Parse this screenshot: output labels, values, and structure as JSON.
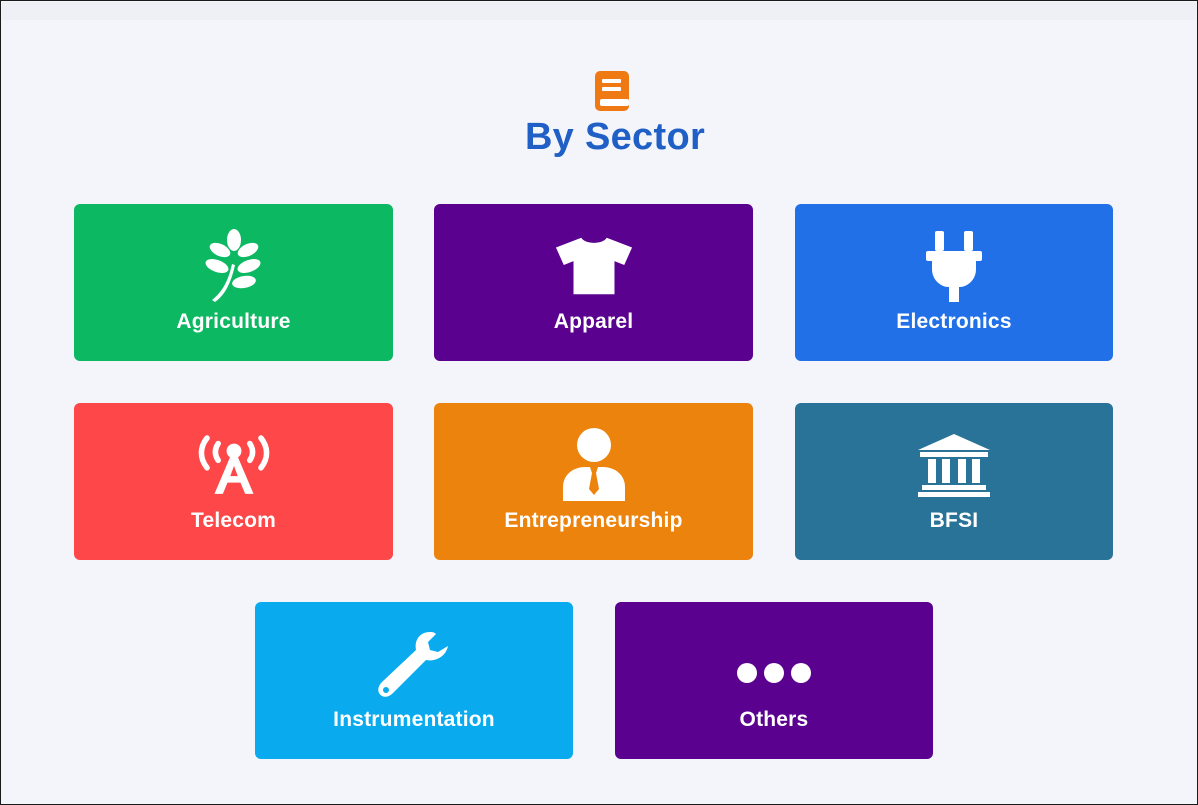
{
  "header": {
    "title": "By Sector",
    "icon": "book-icon",
    "icon_color": "#ef7a14",
    "title_color": "#1f5fc6"
  },
  "sectors": [
    {
      "label": "Agriculture",
      "icon": "leaf-icon",
      "color": "#0db862"
    },
    {
      "label": "Apparel",
      "icon": "tshirt-icon",
      "color": "#5a028f"
    },
    {
      "label": "Electronics",
      "icon": "plug-icon",
      "color": "#2170e8"
    },
    {
      "label": "Telecom",
      "icon": "broadcast-tower-icon",
      "color": "#fe4748"
    },
    {
      "label": "Entrepreneurship",
      "icon": "businessman-icon",
      "color": "#ec830c"
    },
    {
      "label": "BFSI",
      "icon": "bank-icon",
      "color": "#287397"
    },
    {
      "label": "Instrumentation",
      "icon": "wrench-icon",
      "color": "#0aabee"
    },
    {
      "label": "Others",
      "icon": "ellipsis-icon",
      "color": "#5a028f"
    }
  ]
}
